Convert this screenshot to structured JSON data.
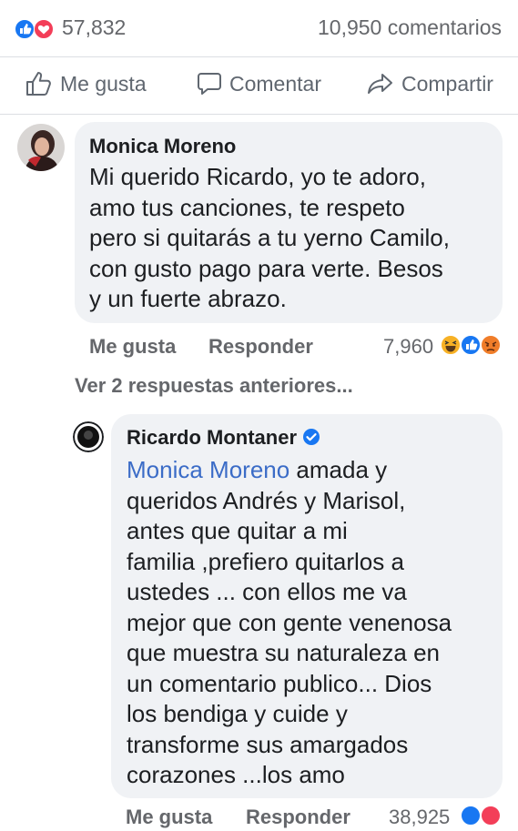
{
  "post_stats": {
    "likes_count": "57,832",
    "comments_count": "10,950 comentarios",
    "reaction_icons": [
      "like-icon",
      "love-icon"
    ]
  },
  "actions": {
    "like_label": "Me gusta",
    "comment_label": "Comentar",
    "share_label": "Compartir"
  },
  "comment": {
    "author": "Monica Moreno",
    "text": "Mi querido Ricardo, yo te adoro,\namo tus canciones, te respeto\npero si quitarás a tu yerno Camilo,\ncon gusto pago para verte. Besos\ny un fuerte abrazo.",
    "like_label": "Me gusta",
    "reply_label": "Responder",
    "reaction_count": "7,960",
    "reaction_icons": [
      "haha-icon",
      "like-icon",
      "angry-icon"
    ]
  },
  "view_previous_replies": "Ver 2 respuestas anteriores...",
  "reply": {
    "author": "Ricardo Montaner",
    "verified": true,
    "mention": "Monica Moreno",
    "text_after_mention": " amada y\nqueridos  Andrés y Marisol,\nantes que quitar a mi\nfamilia ,prefiero quitarlos a\nustedes ... con ellos me va\nmejor que con gente venenosa\nque muestra su naturaleza en\nun comentario publico... Dios\nlos bendiga y cuide y\ntransforme sus amargados\ncorazones ...los amo",
    "like_label": "Me gusta",
    "reply_label": "Responder",
    "reaction_count": "38,925",
    "reaction_icons": [
      "like-icon",
      "love-icon"
    ]
  },
  "colors": {
    "bubble": "#f0f2f5",
    "like_blue": "#1877f2",
    "love_red": "#f33e58",
    "mention_blue": "#3b6cc7",
    "secondary_text": "#65676b"
  }
}
